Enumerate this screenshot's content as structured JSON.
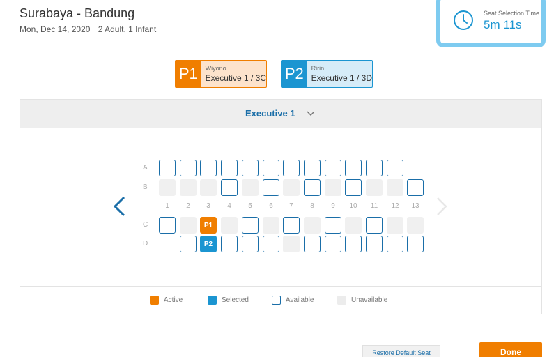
{
  "header": {
    "route": "Surabaya - Bandung",
    "date": "Mon, Dec 14, 2020",
    "passengers": "2 Adult, 1 Infant"
  },
  "timer": {
    "label": "Seat Selection Time",
    "value": "5m 11s",
    "icon": "clock-icon"
  },
  "passengers": [
    {
      "code": "P1",
      "name": "Wiyono",
      "seat": "Executive 1 / 3C",
      "color": "#f07e00"
    },
    {
      "code": "P2",
      "name": "Ririn",
      "seat": "Executive 1 / 3D",
      "color": "#1b95d1"
    }
  ],
  "coach": {
    "name": "Executive 1",
    "icon": "chevron-down-icon"
  },
  "seat_map": {
    "row_labels": [
      "A",
      "B",
      "C",
      "D"
    ],
    "col_labels": [
      "1",
      "2",
      "3",
      "4",
      "5",
      "6",
      "7",
      "8",
      "9",
      "10",
      "11",
      "12",
      "13"
    ],
    "rows": [
      [
        "available",
        "available",
        "available",
        "available",
        "available",
        "available",
        "available",
        "available",
        "available",
        "available",
        "available",
        "available",
        null
      ],
      [
        "unavailable",
        "unavailable",
        "unavailable",
        "available",
        "unavailable",
        "available",
        "unavailable",
        "available",
        "unavailable",
        "available",
        "unavailable",
        "unavailable",
        "available"
      ],
      [
        "available",
        "unavailable",
        "active",
        "unavailable",
        "available",
        "unavailable",
        "available",
        "unavailable",
        "available",
        "unavailable",
        "available",
        "unavailable",
        "unavailable"
      ],
      [
        null,
        "available",
        "selected",
        "available",
        "available",
        "available",
        "unavailable",
        "available",
        "available",
        "available",
        "available",
        "available",
        "available"
      ]
    ],
    "seat_tags": {
      "active": "P1",
      "selected": "P2"
    }
  },
  "legend": [
    {
      "key": "active",
      "label": "Active"
    },
    {
      "key": "selected",
      "label": "Selected"
    },
    {
      "key": "available",
      "label": "Available"
    },
    {
      "key": "unavailable",
      "label": "Unavailable"
    }
  ],
  "actions": {
    "restore_label": "Restore Default Seat",
    "done_label": "Done"
  },
  "colors": {
    "accent_orange": "#f07e00",
    "accent_blue": "#1b95d1",
    "link_blue": "#1a6ea8"
  }
}
